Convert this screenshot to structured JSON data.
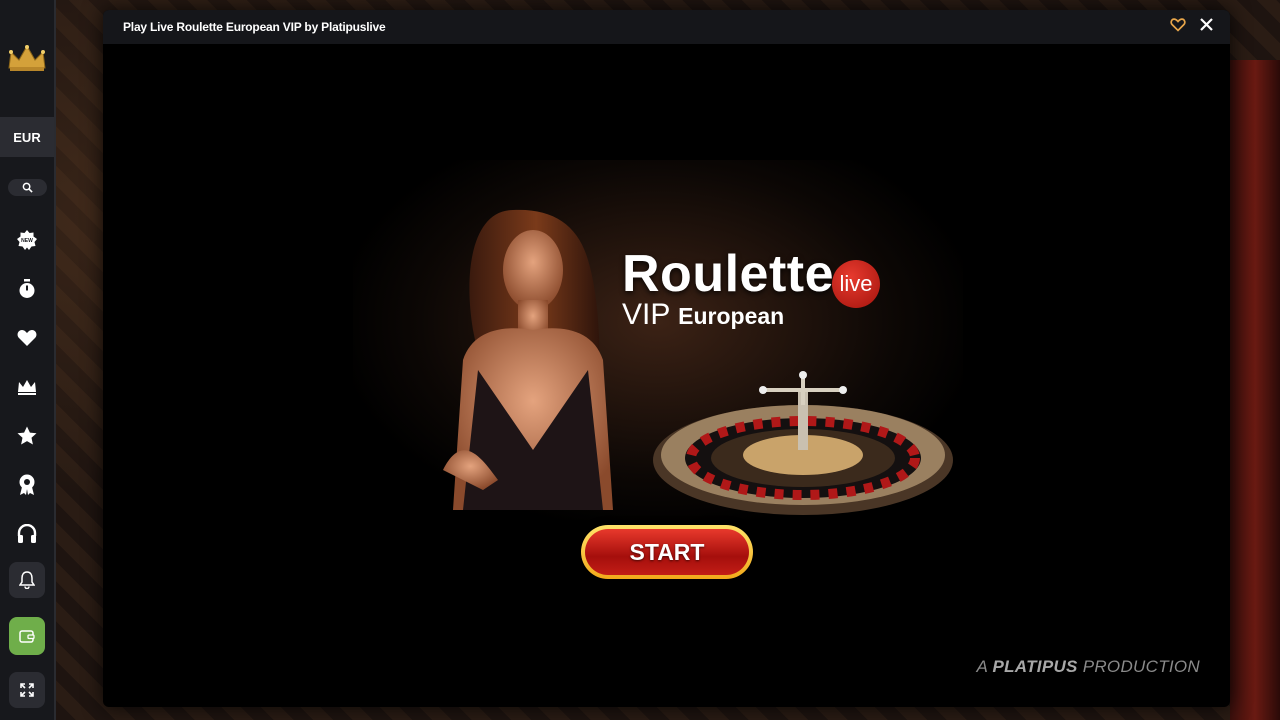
{
  "sidebar": {
    "currency": "EUR",
    "icons": [
      "crown-logo-icon",
      "search-icon",
      "new-badge-icon",
      "stopwatch-icon",
      "heart-icon",
      "crown-icon",
      "star-icon",
      "award-icon",
      "headset-icon",
      "bell-icon",
      "wallet-icon",
      "expand-icon"
    ],
    "wallet_color": "#6fae4a"
  },
  "modal": {
    "title": "Play Live Roulette European VIP by Platipuslive",
    "favorite_color": "#e8a64a"
  },
  "game": {
    "title_main": "Roulette",
    "live_badge": "live",
    "title_vip": "VIP",
    "title_european": "European",
    "start_label": "START",
    "production_prefix": "A",
    "production_brand": "PLATIPUS",
    "production_suffix": "PRODUCTION"
  }
}
